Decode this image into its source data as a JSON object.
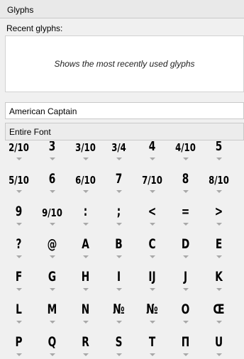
{
  "panel": {
    "title": "Glyphs"
  },
  "recent": {
    "label": "Recent glyphs:",
    "hint": "Shows the most recently used glyphs"
  },
  "font_name": "American Captain",
  "glyph_set": "Entire Font",
  "glyph_rows": [
    [
      "2/10",
      "3",
      "3/10",
      "3/4",
      "4",
      "4/10",
      "5"
    ],
    [
      "5/10",
      "6",
      "6/10",
      "7",
      "7/10",
      "8",
      "8/10"
    ],
    [
      "9",
      "9/10",
      ":",
      ";",
      "<",
      "=",
      ">"
    ],
    [
      "?",
      "@",
      "A",
      "B",
      "C",
      "D",
      "E"
    ],
    [
      "F",
      "G",
      "H",
      "I",
      "IJ",
      "J",
      "K"
    ],
    [
      "L",
      "M",
      "N",
      "№",
      "№",
      "O",
      "Œ"
    ],
    [
      "P",
      "Q",
      "R",
      "S",
      "T",
      "Π",
      "U"
    ]
  ]
}
